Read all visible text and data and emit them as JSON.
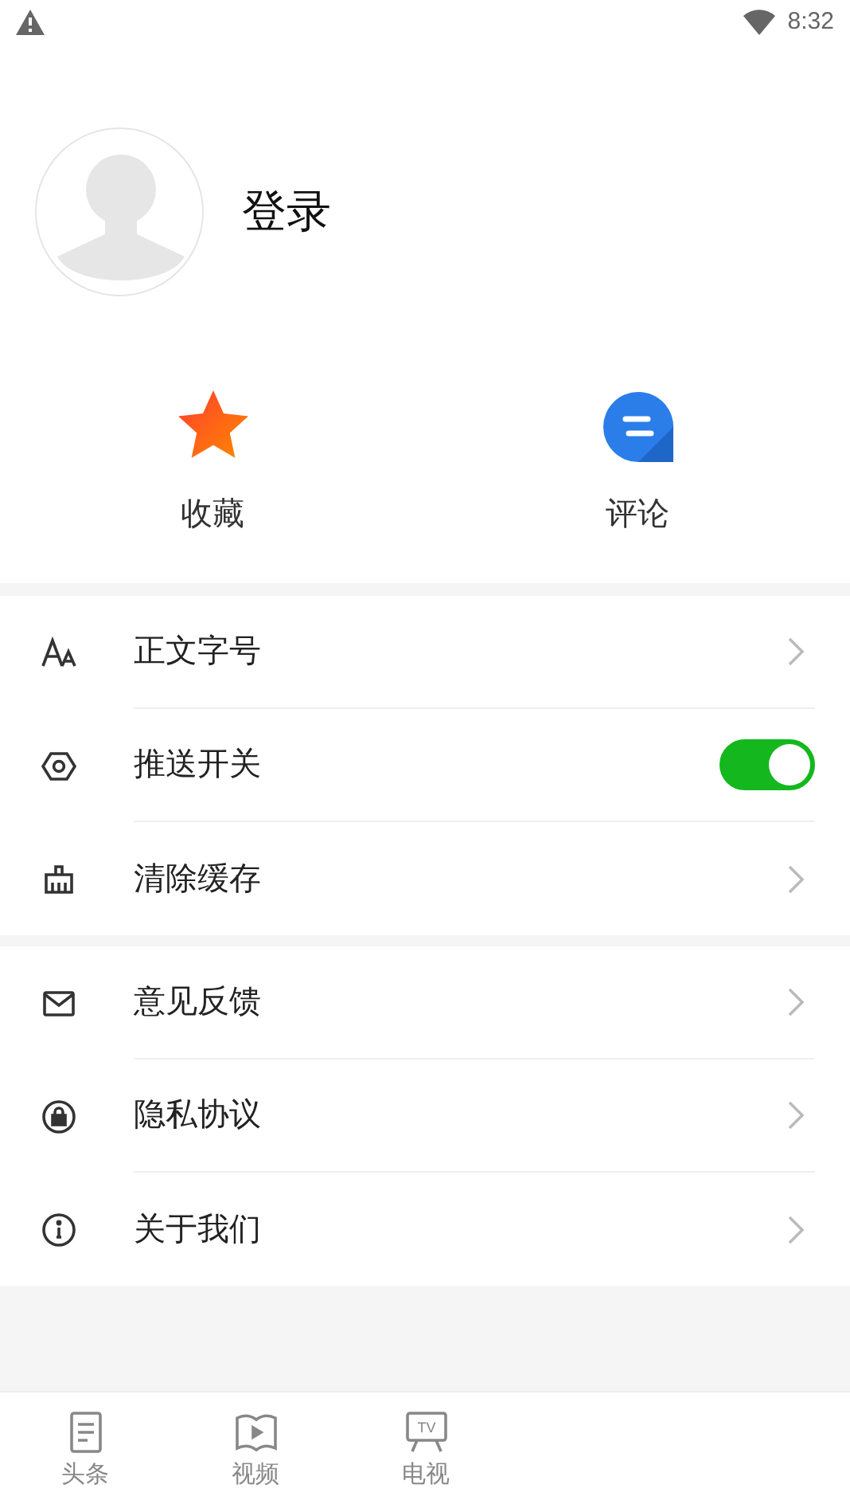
{
  "status_bar": {
    "time": "8:32"
  },
  "profile": {
    "login_label": "登录"
  },
  "quick_actions": [
    {
      "kind": "star",
      "label": "收藏"
    },
    {
      "kind": "comment",
      "label": "评论"
    }
  ],
  "settings_groups": [
    [
      {
        "label": "正文字号",
        "kind": "link"
      },
      {
        "label": "推送开关",
        "kind": "switch",
        "on": true
      },
      {
        "label": "清除缓存",
        "kind": "link"
      }
    ],
    [
      {
        "label": "意见反馈",
        "kind": "link"
      },
      {
        "label": "隐私协议",
        "kind": "link"
      },
      {
        "label": "关于我们",
        "kind": "link"
      }
    ]
  ],
  "bottom_nav": [
    {
      "label": "头条",
      "selected": false
    },
    {
      "label": "视频",
      "selected": false
    },
    {
      "icon_text": "TV",
      "label": "电视",
      "selected": false
    }
  ]
}
